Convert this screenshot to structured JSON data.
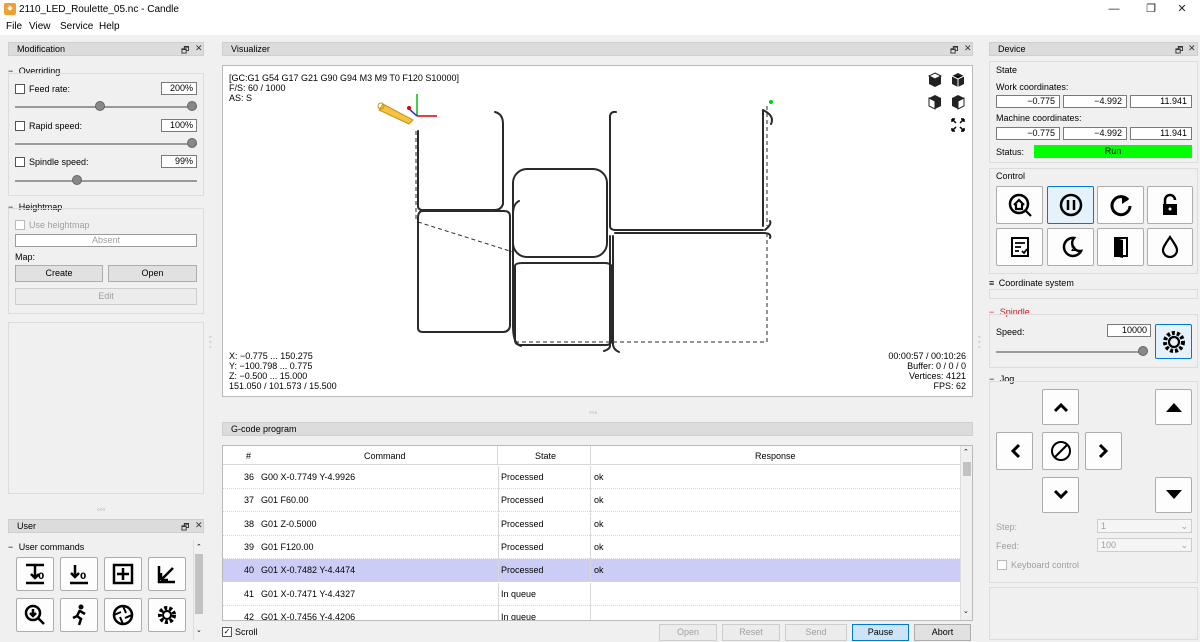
{
  "window": {
    "title": "2110_LED_Roulette_05.nc - Candle",
    "icon": "candle-app-icon",
    "minimize": "—",
    "maximize": "❐",
    "close": "✕"
  },
  "menu": [
    "File",
    "View",
    "Service",
    "Help"
  ],
  "modification": {
    "title": "Modification",
    "overriding": {
      "label": "Overriding",
      "feed_label": "Feed rate:",
      "feed_value": "200%",
      "feed_level": 1.0,
      "rapid_label": "Rapid speed:",
      "rapid_value": "100%",
      "rapid_level": 1.0,
      "spindle_label": "Spindle speed:",
      "spindle_value": "99%",
      "spindle_level": 0.35
    },
    "heightmap": {
      "label": "Heightmap",
      "use_label": "Use heightmap",
      "absent": "Absent",
      "map_label": "Map:",
      "create": "Create",
      "open": "Open",
      "edit": "Edit"
    }
  },
  "user": {
    "title": "User",
    "commands_label": "User commands"
  },
  "visualizer": {
    "title": "Visualizer",
    "status_lines": [
      "[GC:G1 G54 G17 G21 G90 G94 M3 M9 T0 F120 S10000]",
      "F/S: 60 / 1000",
      "AS: S"
    ],
    "bounds_lines": [
      "X: −0.775 ... 150.275",
      "Y: −100.798 ... 0.775",
      "Z: −0.500 ... 15.000",
      "151.050 / 101.573 / 15.500"
    ],
    "info_lines": [
      "00:00:57 / 00:10:26",
      "Buffer: 0 / 0 / 0",
      "Vertices: 4121",
      "FPS: 62"
    ]
  },
  "gcode": {
    "title": "G-code program",
    "headers": {
      "num": "#",
      "command": "Command",
      "state": "State",
      "response": "Response"
    },
    "rows": [
      {
        "num": "36",
        "command": "G00 X-0.7749 Y-4.9926",
        "state": "Processed",
        "response": "ok"
      },
      {
        "num": "37",
        "command": "G01 F60.00",
        "state": "Processed",
        "response": "ok"
      },
      {
        "num": "38",
        "command": "G01 Z-0.5000",
        "state": "Processed",
        "response": "ok"
      },
      {
        "num": "39",
        "command": "G01 F120.00",
        "state": "Processed",
        "response": "ok"
      },
      {
        "num": "40",
        "command": "G01 X-0.7482 Y-4.4474",
        "state": "Processed",
        "response": "ok"
      },
      {
        "num": "41",
        "command": "G01 X-0.7471 Y-4.4327",
        "state": "In queue",
        "response": ""
      },
      {
        "num": "42",
        "command": "G01 X-0.7456 Y-4.4206",
        "state": "In queue",
        "response": ""
      }
    ],
    "scroll_label": "Scroll",
    "buttons": {
      "open": "Open",
      "reset": "Reset",
      "send": "Send",
      "pause": "Pause",
      "abort": "Abort"
    }
  },
  "device": {
    "title": "Device",
    "state_label": "State",
    "work_label": "Work coordinates:",
    "work": [
      "−0.775",
      "−4.992",
      "11.941"
    ],
    "machine_label": "Machine coordinates:",
    "machine": [
      "−0.775",
      "−4.992",
      "11.941"
    ],
    "status_label": "Status:",
    "status_value": "Run",
    "status_color": "#00ff00",
    "control_label": "Control",
    "coord_system_label": "Coordinate system",
    "spindle_label": "Spindle",
    "speed_label": "Speed:",
    "speed_value": "10000",
    "speed_level": 1.0,
    "jog_label": "Jog",
    "step_label": "Step:",
    "step_value": "1",
    "feed_label": "Feed:",
    "feed_value": "100",
    "keyboard_label": "Keyboard control"
  },
  "colors": {
    "spindle_title": "#d02020",
    "selected_row": "#cccdf6",
    "pause_btn": "#cce4f7"
  }
}
